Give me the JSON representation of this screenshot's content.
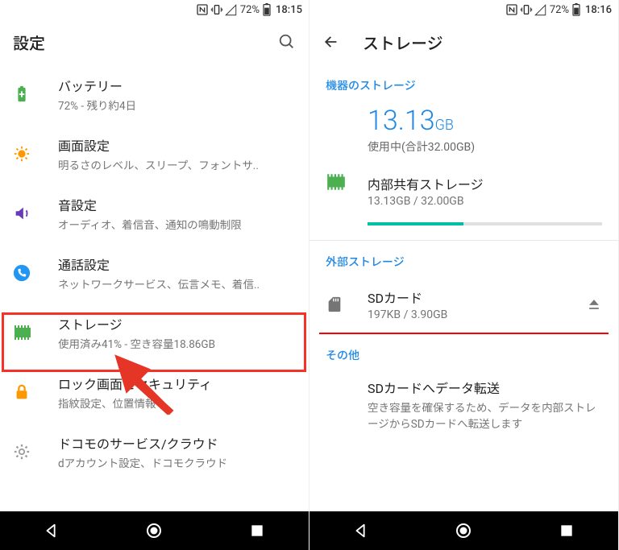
{
  "left": {
    "status": {
      "battery_pct": "72%",
      "time": "18:15"
    },
    "appbar": {
      "title": "設定"
    },
    "items": [
      {
        "icon": "battery",
        "color": "#4caf50",
        "title": "バッテリー",
        "subtitle": "72% - 残り約4日"
      },
      {
        "icon": "brightness",
        "color": "#ff9800",
        "title": "画面設定",
        "subtitle": "明るさのレベル、スリープ、フォントサ.."
      },
      {
        "icon": "sound",
        "color": "#673ab7",
        "title": "音設定",
        "subtitle": "オーディオ、着信音、通知の鳴動制限"
      },
      {
        "icon": "call",
        "color": "#2196f3",
        "title": "通話設定",
        "subtitle": "ネットワークサービス、伝言メモ、着信.."
      },
      {
        "icon": "storage",
        "color": "#4caf50",
        "title": "ストレージ",
        "subtitle": "使用済み41% - 空き容量18.86GB"
      },
      {
        "icon": "lock",
        "color": "#ff9800",
        "title": "ロック画面とセキュリティ",
        "subtitle": "指紋設定、位置情報"
      },
      {
        "icon": "gear",
        "color": "#9e9e9e",
        "title": "ドコモのサービス/クラウド",
        "subtitle": "dアカウント設定、ドコモクラウド"
      }
    ]
  },
  "right": {
    "status": {
      "battery_pct": "72%",
      "time": "18:16"
    },
    "appbar": {
      "title": "ストレージ"
    },
    "section_device": "機器のストレージ",
    "big_value": "13.13",
    "big_unit": "GB",
    "used_line": "使用中(合計32.00GB)",
    "internal": {
      "title": "内部共有ストレージ",
      "subtitle": "13.13GB / 32.00GB",
      "fill_pct": 41
    },
    "section_external": "外部ストレージ",
    "sd": {
      "title": "SDカード",
      "subtitle": "197KB / 3.90GB"
    },
    "section_other": "その他",
    "transfer": {
      "title": "SDカードへデータ転送",
      "subtitle": "空き容量を確保するため、データを内部ストレージからSDカードへ転送します"
    }
  }
}
